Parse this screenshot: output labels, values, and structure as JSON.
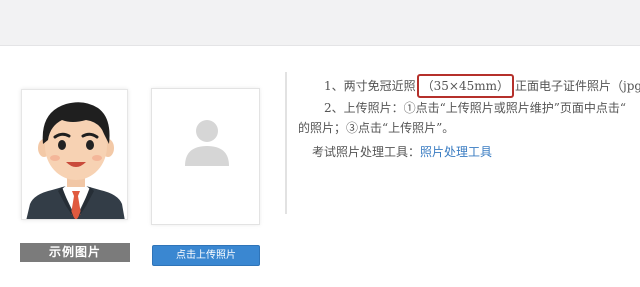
{
  "instructions": {
    "line1_prefix": "1、两寸免冠近照",
    "line1_size": "（35×45mm）",
    "line1_suffix": "正面电子证件照片（jpg格式,",
    "line2": "2、上传照片：①点击“上传照片或照片维护”页面中点击“",
    "line3": "的照片；③点击“上传照片”。",
    "tool_label": "考试照片处理工具：",
    "tool_link": "照片处理工具"
  },
  "photos": {
    "sample_label": "示例图片",
    "upload_button_label": "点击上传照片",
    "placeholder_icon": "user-silhouette-icon"
  },
  "colors": {
    "top_bar": "#f2f2f3",
    "upload_button": "#3a87d1",
    "sample_label": "#7b7b7b",
    "highlight_box": "#b5302b",
    "link": "#3a7cc2"
  }
}
